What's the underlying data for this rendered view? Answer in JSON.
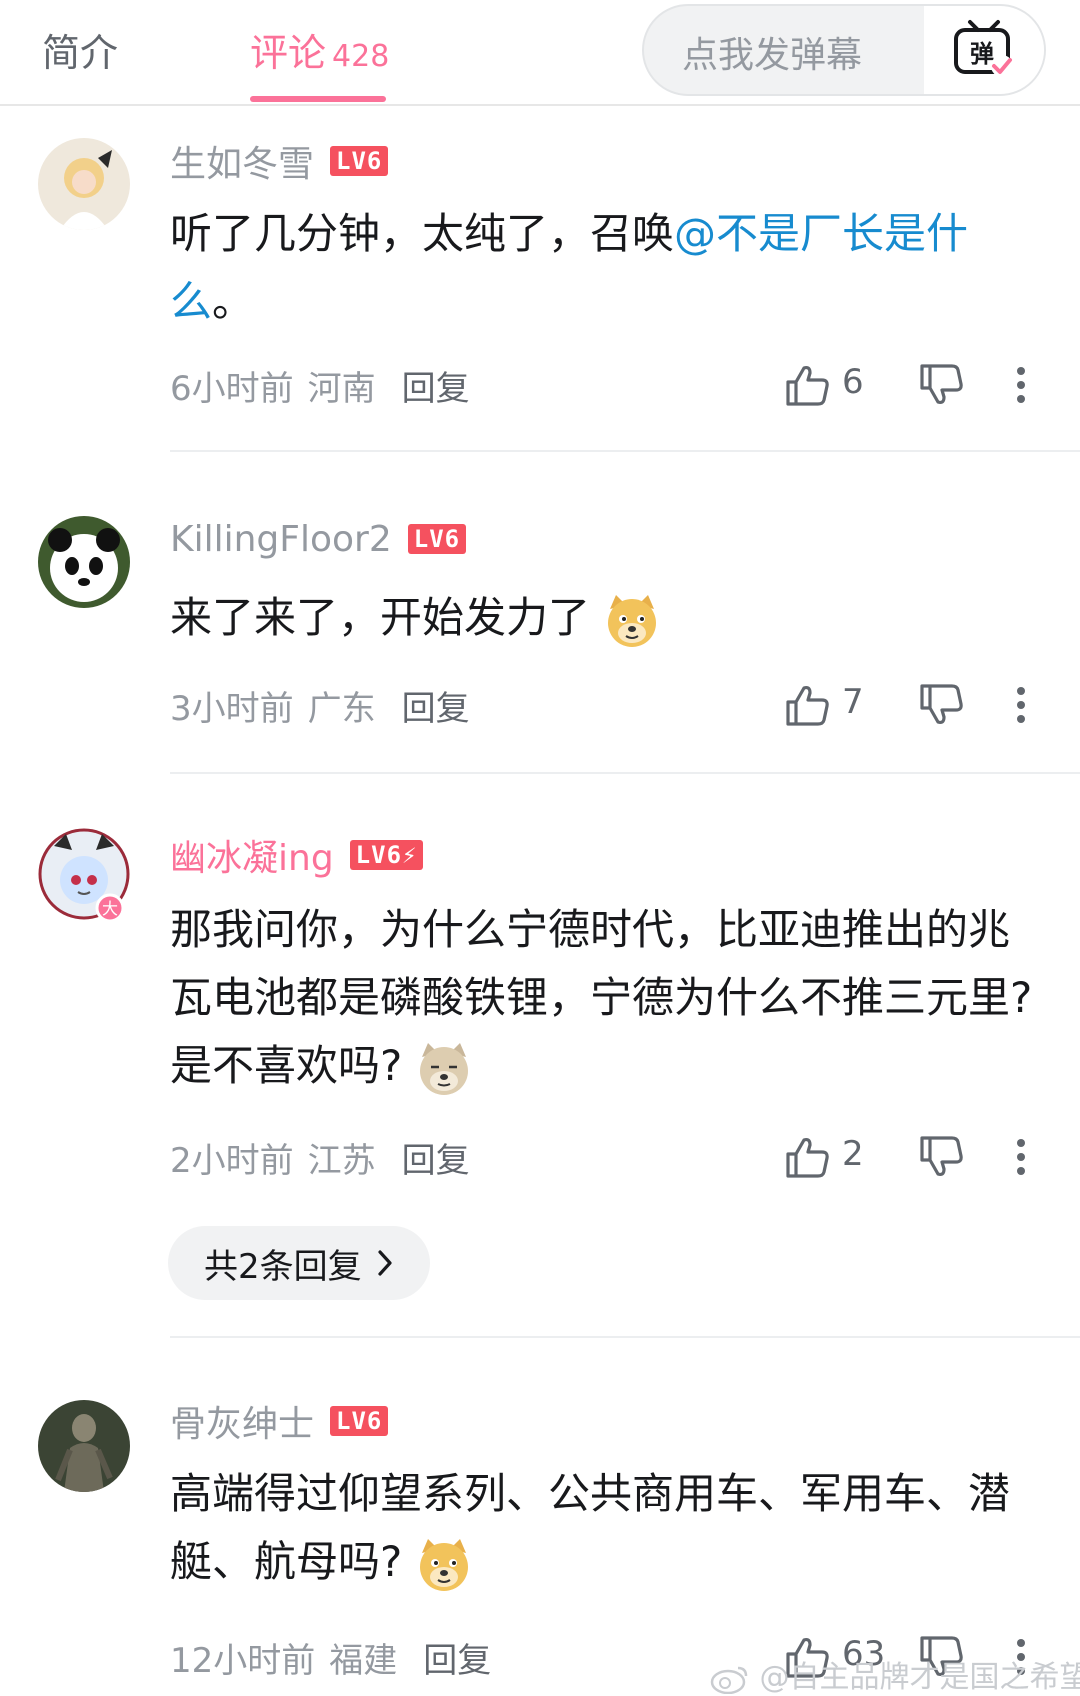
{
  "tabs": {
    "intro": "简介",
    "comments": "评论",
    "comment_count": "428"
  },
  "danmaku": {
    "placeholder": "点我发弹幕",
    "button_glyph": "弹"
  },
  "comments": [
    {
      "username": "生如冬雪",
      "level": "LV6",
      "text_before": "听了几分钟，太纯了，召唤",
      "mention": "@不是厂长是什么",
      "text_after": "。",
      "time": "6小时前",
      "location": "河南",
      "reply_label": "回复",
      "likes": "6"
    },
    {
      "username": "KillingFloor2",
      "level": "LV6",
      "text": "来了来了，开始发力了",
      "emoji": "doge-emoji",
      "time": "3小时前",
      "location": "广东",
      "reply_label": "回复",
      "likes": "7"
    },
    {
      "username": "幽冰凝ing",
      "level": "LV6⚡",
      "text": "那我问你，为什么宁德时代，比亚迪推出的兆瓦电池都是磷酸铁锂，宁德为什么不推三元里?是不喜欢吗?",
      "emoji": "doge-emoji",
      "time": "2小时前",
      "location": "江苏",
      "reply_label": "回复",
      "likes": "2",
      "replies_label": "共2条回复"
    },
    {
      "username": "骨灰绅士",
      "level": "LV6",
      "text": "高端得过仰望系列、公共商用车、军用车、潜艇、航母吗?",
      "emoji": "doge-emoji",
      "time": "12小时前",
      "location": "福建",
      "reply_label": "回复",
      "likes": "63"
    }
  ],
  "watermark": "@自主品牌才是国之希望",
  "colors": {
    "accent": "#fb7299",
    "level_badge": "#f5515f",
    "mention": "#178bcf",
    "muted": "#9499a0"
  },
  "icons": [
    "danmaku-tv-icon",
    "thumb-up-icon",
    "thumb-down-icon",
    "more-vertical-icon",
    "chevron-right-icon",
    "weibo-icon"
  ]
}
